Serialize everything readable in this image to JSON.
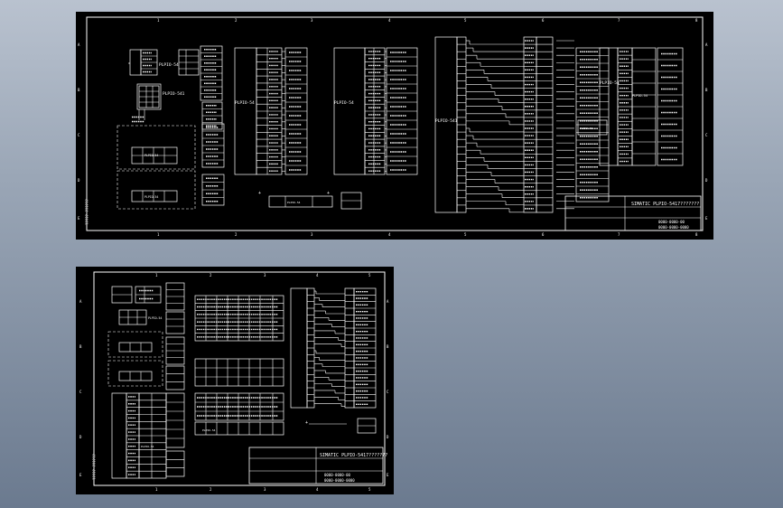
{
  "sheet_top": {
    "title": "SIMATIC PLPIO-5417???????",
    "drawing_no_1": "0000-0000-00",
    "drawing_no_2": "0000-0000-0000",
    "modules": [
      "PLPIO-54",
      "PLPIO-541",
      "PLPIO-54",
      "PLPIO-54",
      "PLPIO-541",
      "PLPIO-54"
    ],
    "side_note": "????? ??????"
  },
  "sheet_bottom": {
    "title": "SIMATIC PLPIO-5417???????",
    "drawing_no_1": "0000-0000-00",
    "drawing_no_2": "0000-0000-0000",
    "side_note": "????? ??????"
  },
  "grid_numbers": [
    "1",
    "2",
    "3",
    "4",
    "5",
    "6",
    "7",
    "8"
  ],
  "grid_letters": [
    "A",
    "B",
    "C",
    "D",
    "E"
  ]
}
